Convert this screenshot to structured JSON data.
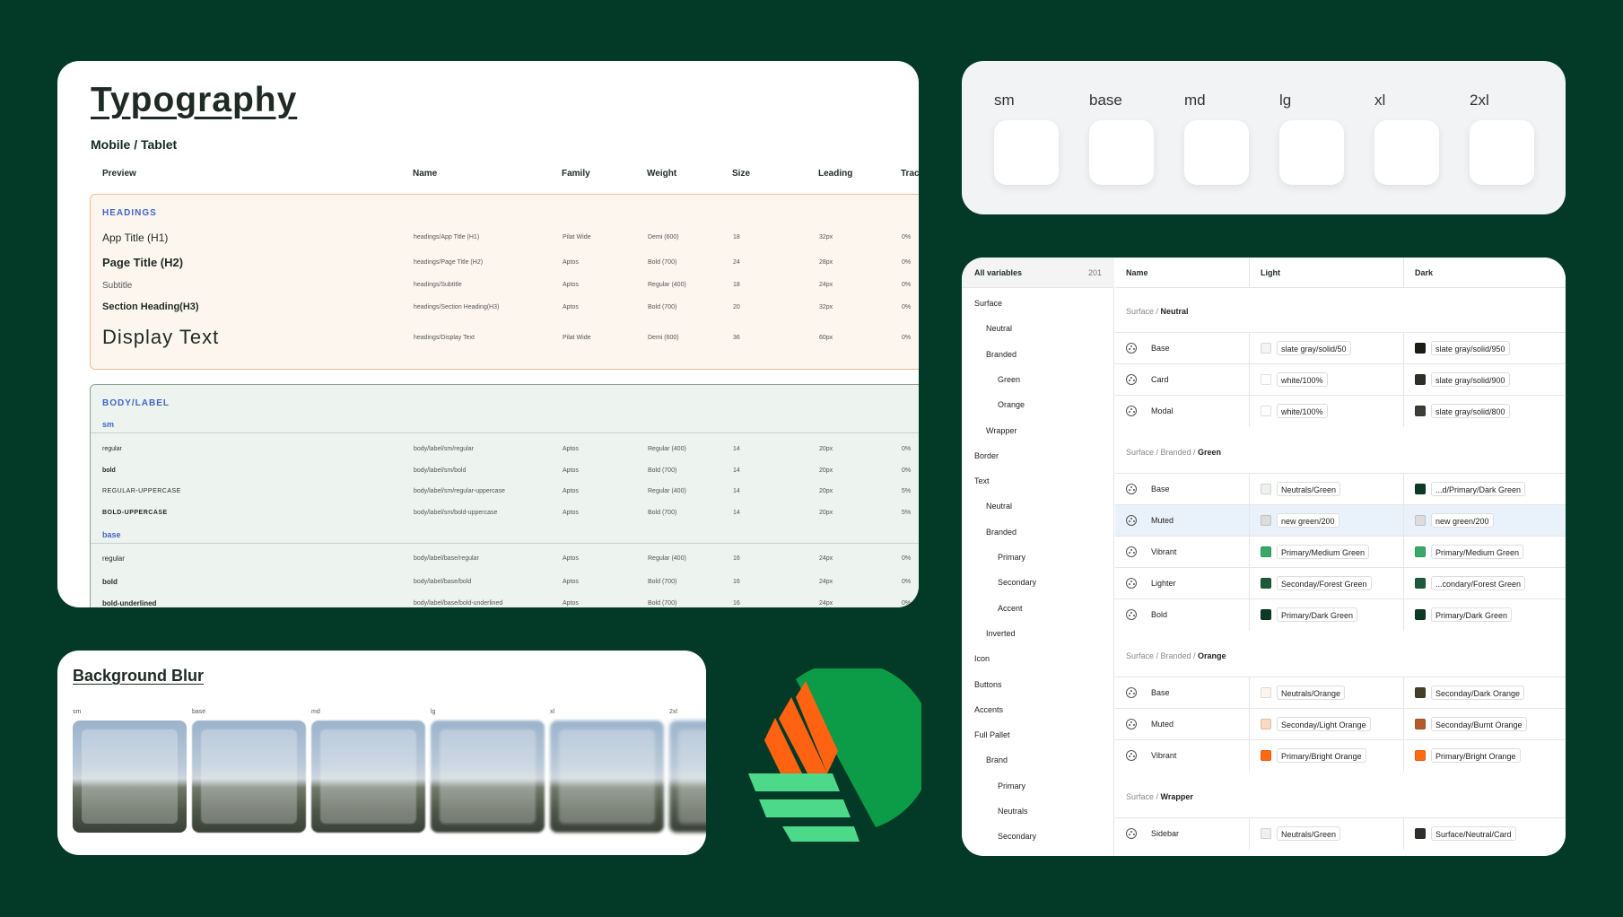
{
  "typography": {
    "title": "Typography",
    "subtitle": "Mobile / Tablet",
    "columns": [
      "Preview",
      "Name",
      "Family",
      "Weight",
      "Size",
      "Leading",
      "Trac"
    ],
    "headings_label": "HEADINGS",
    "headings": [
      {
        "preview": "App Title (H1)",
        "name": "headings/App Title (H1)",
        "family": "Pilat Wide",
        "weight": "Demi (600)",
        "size": "18",
        "leading": "32px",
        "tracking": "0%"
      },
      {
        "preview": "Page Title (H2)",
        "name": "headings/Page Title (H2)",
        "family": "Aptos",
        "weight": "Bold (700)",
        "size": "24",
        "leading": "28px",
        "tracking": "0%"
      },
      {
        "preview": "Subtitle",
        "name": "headings/Subtitle",
        "family": "Aptos",
        "weight": "Regular (400)",
        "size": "18",
        "leading": "24px",
        "tracking": "0%"
      },
      {
        "preview": "Section Heading(H3)",
        "name": "headings/Section Heading(H3)",
        "family": "Aptos",
        "weight": "Bold (700)",
        "size": "20",
        "leading": "32px",
        "tracking": "0%"
      },
      {
        "preview": "Display Text",
        "name": "headings/Display Text",
        "family": "Pilat Wide",
        "weight": "Demi (600)",
        "size": "36",
        "leading": "60px",
        "tracking": "0%"
      }
    ],
    "body_label": "BODY/LABEL",
    "sm_label": "sm",
    "sm_rows": [
      {
        "preview": "regular",
        "name": "body/label/sm/regular",
        "family": "Aptos",
        "weight": "Regular (400)",
        "size": "14",
        "leading": "20px",
        "tracking": "0%"
      },
      {
        "preview": "bold",
        "name": "body/label/sm/bold",
        "family": "Aptos",
        "weight": "Bold (700)",
        "size": "14",
        "leading": "20px",
        "tracking": "0%"
      },
      {
        "preview": "REGULAR-UPPERCASE",
        "name": "body/label/sm/regular-uppercase",
        "family": "Aptos",
        "weight": "Regular (400)",
        "size": "14",
        "leading": "20px",
        "tracking": "5%"
      },
      {
        "preview": "BOLD-UPPERCASE",
        "name": "body/label/sm/bold-uppercase",
        "family": "Aptos",
        "weight": "Bold (700)",
        "size": "14",
        "leading": "20px",
        "tracking": "5%"
      }
    ],
    "base_label": "base",
    "base_rows": [
      {
        "preview": "regular",
        "name": "body/label/base/regular",
        "family": "Aptos",
        "weight": "Regular (400)",
        "size": "16",
        "leading": "24px",
        "tracking": "0%"
      },
      {
        "preview": "bold",
        "name": "body/label/base/bold",
        "family": "Aptos",
        "weight": "Bold (700)",
        "size": "16",
        "leading": "24px",
        "tracking": "0%"
      },
      {
        "preview": "bold-underlined",
        "name": "body/label/base/bold-underlined",
        "family": "Aptos",
        "weight": "Bold (700)",
        "size": "16",
        "leading": "24px",
        "tracking": "0%"
      }
    ]
  },
  "radius_sizes": [
    "sm",
    "base",
    "md",
    "lg",
    "xl",
    "2xl"
  ],
  "background_blur": {
    "title": "Background Blur",
    "sizes": [
      "sm",
      "base",
      "md",
      "lg",
      "xl",
      "2xl"
    ]
  },
  "variables": {
    "sidebar_title": "All variables",
    "count": "201",
    "sidebar_items": [
      "Surface",
      "Neutral",
      "Branded",
      "Green",
      "Orange",
      "Wrapper",
      "Border",
      "Text",
      "Neutral",
      "Branded",
      "Primary",
      "Secondary",
      "Accent",
      "Inverted",
      "Icon",
      "Buttons",
      "Accents",
      "Full Pallet",
      "Brand",
      "Primary",
      "Neutrals",
      "Secondary"
    ],
    "columns": [
      "Name",
      "Light",
      "Dark"
    ],
    "groups": [
      {
        "path": "Surface / ",
        "leaf": "Neutral",
        "rows": [
          {
            "name": "Base",
            "light": "slate gray/solid/50",
            "light_color": "#f4f4f4",
            "dark": "slate gray/solid/950",
            "dark_color": "#1c1c16"
          },
          {
            "name": "Card",
            "light": "white/100%",
            "light_color": "#ffffff",
            "dark": "slate gray/solid/900",
            "dark_color": "#2e2e2a"
          },
          {
            "name": "Modal",
            "light": "white/100%",
            "light_color": "#ffffff",
            "dark": "slate gray/solid/800",
            "dark_color": "#3c3c38"
          }
        ]
      },
      {
        "path": "Surface / Branded / ",
        "leaf": "Green",
        "rows": [
          {
            "name": "Base",
            "light": "Neutrals/Green",
            "light_color": "#eef1ee",
            "dark": "...d/Primary/Dark Green",
            "dark_color": "#0c3a27"
          },
          {
            "name": "Muted",
            "light": "new green/200",
            "light_color": "#dcdcdc",
            "dark": "new green/200",
            "dark_color": "#dcdcdc",
            "selected": true
          },
          {
            "name": "Vibrant",
            "light": "Primary/Medium Green",
            "light_color": "#3aa866",
            "dark": "Primary/Medium Green",
            "dark_color": "#3aa866"
          },
          {
            "name": "Lighter",
            "light": "Seconday/Forest Green",
            "light_color": "#1d5a3c",
            "dark": "...condary/Forest Green",
            "dark_color": "#1d5a3c"
          },
          {
            "name": "Bold",
            "light": "Primary/Dark Green",
            "light_color": "#0c3a27",
            "dark": "Primary/Dark Green",
            "dark_color": "#0c3a27"
          }
        ]
      },
      {
        "path": "Surface / Branded / ",
        "leaf": "Orange",
        "rows": [
          {
            "name": "Base",
            "light": "Neutrals/Orange",
            "light_color": "#fbf5ee",
            "dark": "Seconday/Dark Orange",
            "dark_color": "#443f28"
          },
          {
            "name": "Muted",
            "light": "Seconday/Light Orange",
            "light_color": "#fbd9c2",
            "dark": "Seconday/Burnt Orange",
            "dark_color": "#b35b2c"
          },
          {
            "name": "Vibrant",
            "light": "Primary/Bright Orange",
            "light_color": "#ff6a12",
            "dark": "Primary/Bright Orange",
            "dark_color": "#ff6a12"
          }
        ]
      },
      {
        "path": "Surface / ",
        "leaf": "Wrapper",
        "rows": [
          {
            "name": "Sidebar",
            "light": "Neutrals/Green",
            "light_color": "#eef1ee",
            "dark": "Surface/Neutral/Card",
            "dark_color": "#2e2e2a"
          }
        ]
      }
    ]
  },
  "colors": {
    "background": "#023a27",
    "logo_green": "#0c9b46",
    "logo_orange": "#ff6312",
    "logo_light_green": "#4cd98a",
    "accent_blue": "#4166c4"
  }
}
